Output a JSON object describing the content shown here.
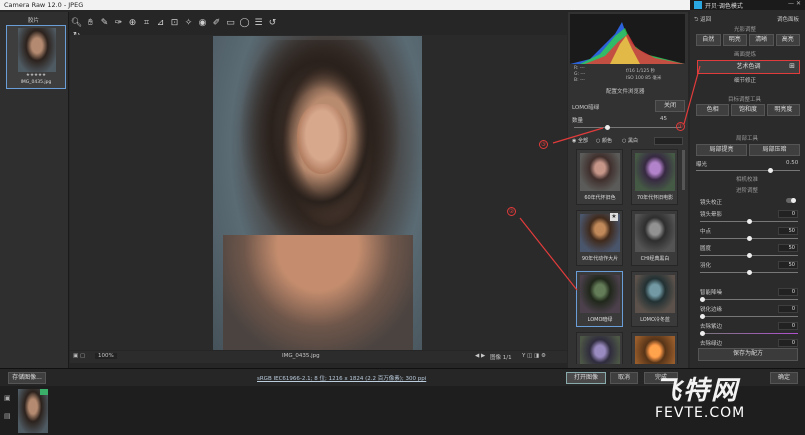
{
  "titlebar": {
    "title": "Camera Raw 12.0 - JPEG"
  },
  "sidepanel_header": {
    "logo_label": "开贝·调色模式"
  },
  "filmstrip": {
    "header": "胶片",
    "item_label": "IMG_0435.jpg",
    "rating": "★★★★★"
  },
  "toolbar": {
    "icons": [
      "zoom-icon",
      "hand-icon",
      "white-balance-icon",
      "color-sampler-icon",
      "target-adjust-icon",
      "crop-icon",
      "straighten-icon",
      "transform-icon",
      "spot-removal-icon",
      "redeye-icon",
      "adjustment-brush-icon",
      "graduated-filter-icon",
      "radial-filter-icon",
      "preferences-icon",
      "rotate-left-icon",
      "rotate-right-icon"
    ]
  },
  "preview": {
    "filename": "IMG_0435.jpg",
    "zoom": "100%",
    "image_counter": "图像 1/1"
  },
  "histogram": {
    "r": "R: ---",
    "g": "G: ---",
    "b": "B: ---",
    "exposure": "f/16  1/125 秒",
    "iso": "ISO 100  85 毫米",
    "profile_manager": "配置文件浏览器"
  },
  "profile_panel": {
    "title": "LOMO暗绿",
    "close": "关闭",
    "amount_label": "数量",
    "amount_value": "45",
    "filters": [
      "全部",
      "颜色",
      "黑白"
    ],
    "thumbs": [
      {
        "label": "60年代怀旧色"
      },
      {
        "label": "70年代怀旧电影"
      },
      {
        "label": "90年代动作大片"
      },
      {
        "label": "CHI经典黑白"
      },
      {
        "label": "LOMO暗绿"
      },
      {
        "label": "LOMO冷冬蓝"
      }
    ]
  },
  "sidepanel": {
    "back": "返回",
    "menu": "调色面板",
    "section_light": "光影调整",
    "tone_buttons": [
      "自然",
      "明亮",
      "清晰",
      "高亮"
    ],
    "section_scene": "画面提炼",
    "art_color": "艺术色调",
    "detail_fix": "细节修正",
    "section_target": "目标调整工具",
    "target_buttons": [
      "色相",
      "饱和度",
      "明亮度"
    ],
    "section_local": "局部工具",
    "local_buttons": [
      "局部提亮",
      "局部压暗"
    ],
    "exposure_label": "曝光",
    "exposure_value": "0.50",
    "section_preset": "相机校准",
    "section_advanced": "进阶调整",
    "lens_label": "镜头校正",
    "sliders": [
      {
        "label": "镜头晕影",
        "value": "0"
      },
      {
        "label": "中点",
        "value": "50"
      },
      {
        "label": "圆度",
        "value": "50"
      },
      {
        "label": "羽化",
        "value": "50"
      },
      {
        "label": "智能降噪",
        "value": "0"
      },
      {
        "label": "锐化边缘",
        "value": "0"
      },
      {
        "label": "去除紫边",
        "value": "0"
      },
      {
        "label": "去除绿边",
        "value": "0"
      }
    ],
    "save_button": "保存为配方",
    "ok_button": "确定"
  },
  "bottombar": {
    "save_image": "存储图像...",
    "info_link": "sRGB IEC61966-2.1; 8 位; 1216 x 1824 (2.2 百万像素); 300 ppi",
    "open_image": "打开图像",
    "cancel": "取消",
    "done": "完成"
  },
  "annotations": {
    "one": "①",
    "two": "②",
    "three": "③"
  },
  "watermark": {
    "brand": "飞特网",
    "url": "FEVTE.COM"
  }
}
